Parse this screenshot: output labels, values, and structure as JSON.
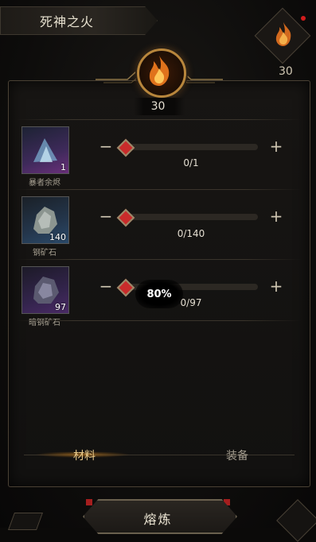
{
  "header": {
    "title": "死神之火",
    "fire_count": "30"
  },
  "center": {
    "count": "30"
  },
  "materials": [
    {
      "name": "暴者余烬",
      "qty": "1",
      "value": "0/1",
      "color": "#6a2f7a"
    },
    {
      "name": "钢矿石",
      "qty": "140",
      "value": "0/140",
      "color": "#2b4a6a"
    },
    {
      "name": "暗钢矿石",
      "qty": "97",
      "value": "0/97",
      "color": "#4a2a66"
    }
  ],
  "overlay": {
    "progress": "80%"
  },
  "tabs": {
    "materials": "材料",
    "equipment": "装备"
  },
  "actions": {
    "smelt": "熔炼"
  }
}
